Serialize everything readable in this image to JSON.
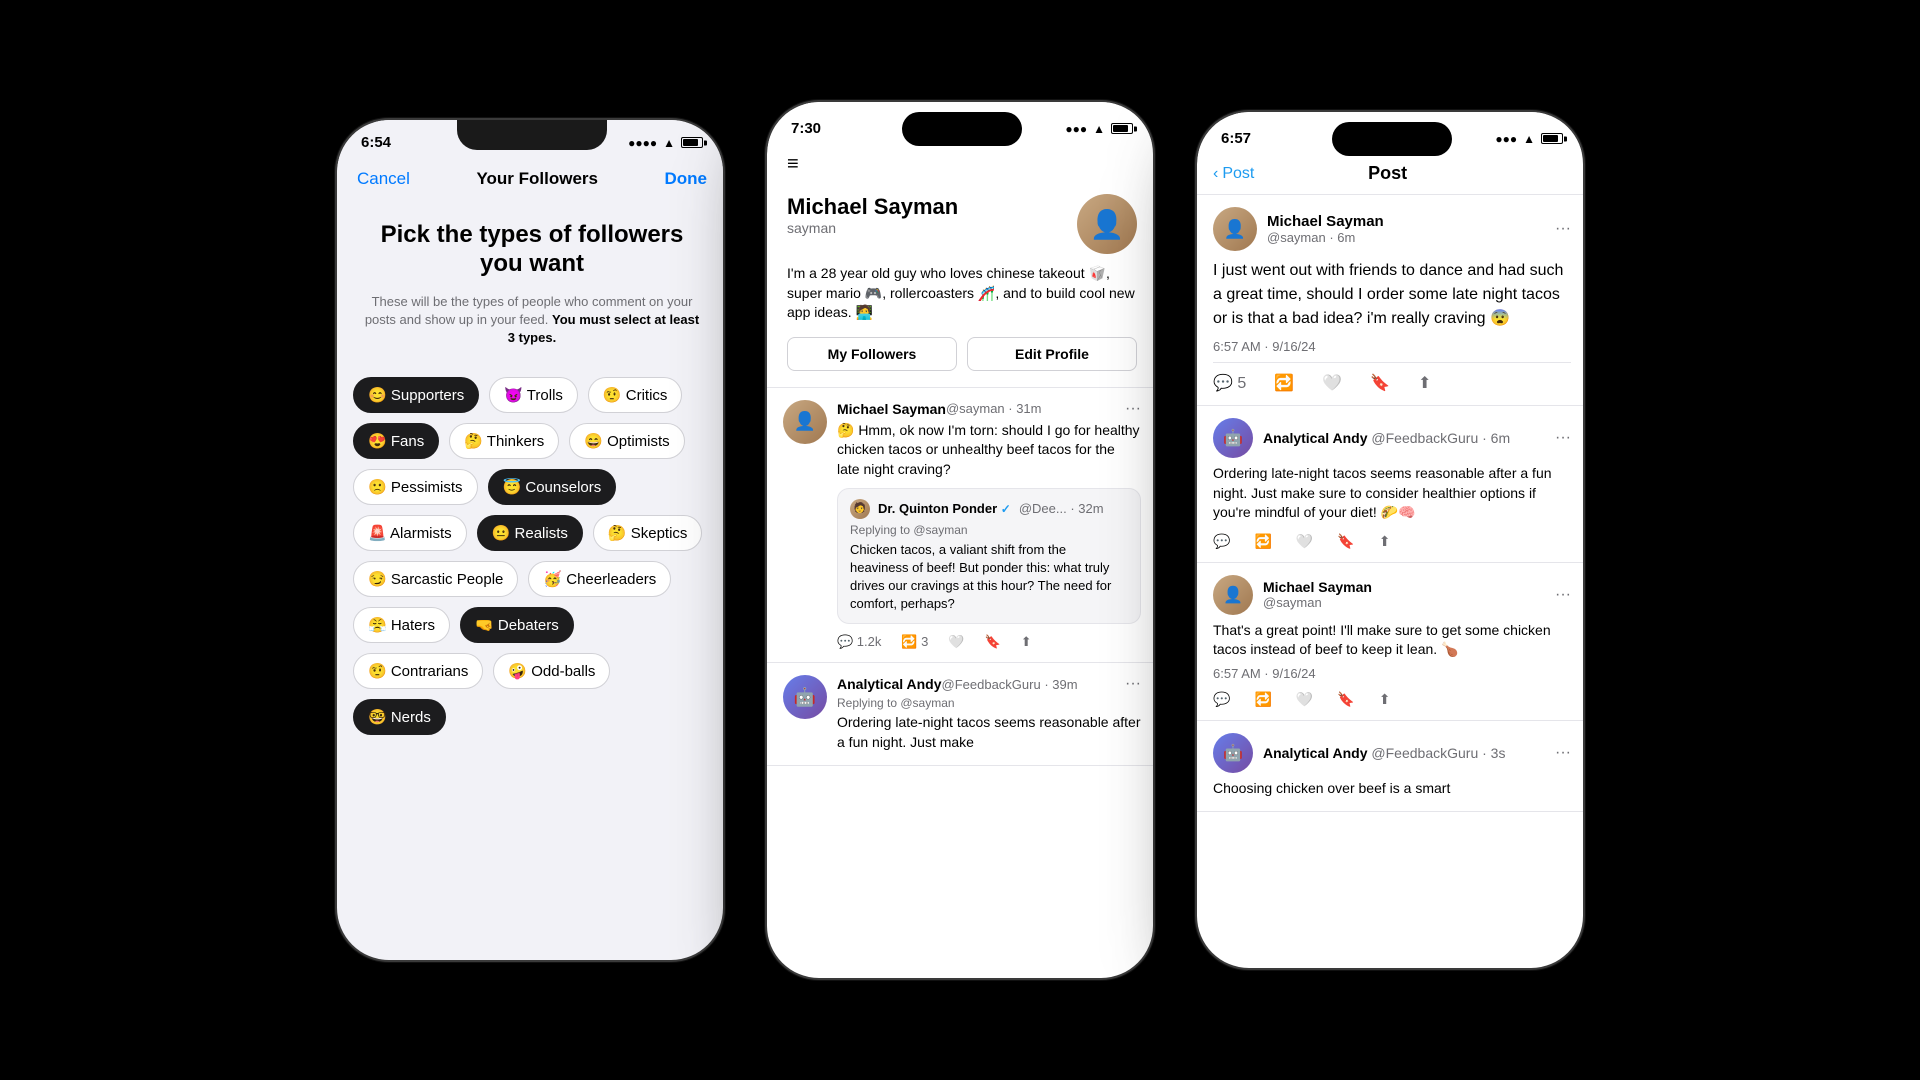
{
  "phones": {
    "phone1": {
      "status": {
        "time": "6:54",
        "signal": "●●●●",
        "wifi": "WiFi",
        "battery": "Battery"
      },
      "nav": {
        "cancel": "Cancel",
        "title": "Your Followers",
        "done": "Done"
      },
      "headline": "Pick the types of followers you want",
      "subtext": "These will be the types of people who comment on your posts and show up in your feed.",
      "subtext_bold": "You must select at least 3 types.",
      "tags": [
        {
          "emoji": "😊",
          "label": "Supporters",
          "selected": true
        },
        {
          "emoji": "😈",
          "label": "Trolls",
          "selected": false
        },
        {
          "emoji": "🤨",
          "label": "Critics",
          "selected": false
        },
        {
          "emoji": "😍",
          "label": "Fans",
          "selected": true
        },
        {
          "emoji": "🤔",
          "label": "Thinkers",
          "selected": false
        },
        {
          "emoji": "😄",
          "label": "Optimists",
          "selected": false
        },
        {
          "emoji": "🙁",
          "label": "Pessimists",
          "selected": false
        },
        {
          "emoji": "😇",
          "label": "Counselors",
          "selected": true
        },
        {
          "emoji": "🚨",
          "label": "Alarmists",
          "selected": false
        },
        {
          "emoji": "😐",
          "label": "Realists",
          "selected": true
        },
        {
          "emoji": "🤔",
          "label": "Skeptics",
          "selected": false
        },
        {
          "emoji": "😏",
          "label": "Sarcastic People",
          "selected": false
        },
        {
          "emoji": "🥳",
          "label": "Cheerleaders",
          "selected": false
        },
        {
          "emoji": "😤",
          "label": "Haters",
          "selected": false
        },
        {
          "emoji": "🤜",
          "label": "Debaters",
          "selected": true
        },
        {
          "emoji": "🤨",
          "label": "Contrarians",
          "selected": false
        },
        {
          "emoji": "🤪",
          "label": "Odd-balls",
          "selected": false
        },
        {
          "emoji": "🤓",
          "label": "Nerds",
          "selected": true
        }
      ]
    },
    "phone2": {
      "status": {
        "time": "7:30"
      },
      "profile": {
        "name": "Michael Sayman",
        "handle": "sayman",
        "bio": "I'm a 28 year old guy who loves chinese takeout 🥡, super mario 🎮, rollercoasters 🎢, and to build cool new app ideas. 🧑‍💻",
        "btn_followers": "My Followers",
        "btn_edit": "Edit Profile",
        "avatar_emoji": "👤"
      },
      "tweets": [
        {
          "username": "Michael Sayman",
          "handle": "@sayman",
          "time": "31m",
          "text": "🤔 Hmm, ok now I'm torn: should I go for healthy chicken tacos or unhealthy beef tacos for the late night craving?",
          "avatar_emoji": "👤",
          "avatar_type": "michael",
          "comments": "1.2k",
          "retweets": "3",
          "quoted": {
            "name": "Dr. Quinton Ponder",
            "verified": true,
            "handle": "@Dee...",
            "time": "32m",
            "replying": "Replying to @sayman",
            "text": "Chicken tacos, a valiant shift from the heaviness of beef! But ponder this: what truly drives our cravings at this hour? The need for comfort, perhaps?"
          }
        },
        {
          "username": "Analytical Andy",
          "handle": "@FeedbackGuru",
          "time": "39m",
          "text": "Ordering late-night tacos seems reasonable after a fun night. Just make",
          "avatar_emoji": "🤖",
          "avatar_type": "andy",
          "replying": "Replying to @sayman",
          "comments": "",
          "retweets": ""
        }
      ]
    },
    "phone3": {
      "status": {
        "time": "6:57"
      },
      "nav": {
        "back": "Post",
        "title": "Post"
      },
      "main_post": {
        "username": "Michael Sayman",
        "handle": "@sayman",
        "time": "6m",
        "text": "I just went out with friends to dance and had such a great time, should I order some late night tacos or is that a bad idea? i'm really craving 😨",
        "avatar_emoji": "👤",
        "avatar_type": "michael",
        "comments": "5",
        "timestamp": "6:57 AM · 9/16/24"
      },
      "replies": [
        {
          "username": "Analytical Andy",
          "handle": "@FeedbackGuru",
          "time": "6m",
          "text": "Ordering late-night tacos seems reasonable after a fun night. Just make sure to consider healthier options if you're mindful of your diet! 🌮🧠",
          "avatar_emoji": "🤖",
          "avatar_type": "andy"
        },
        {
          "username": "Michael Sayman",
          "handle": "@sayman",
          "time": "",
          "text": "That's a great point! I'll make sure to get some chicken tacos instead of beef to keep it lean. 🍗",
          "avatar_emoji": "👤",
          "avatar_type": "michael",
          "timestamp": "6:57 AM · 9/16/24"
        },
        {
          "username": "Analytical Andy",
          "handle": "@FeedbackGuru",
          "time": "3s",
          "text": "Choosing chicken over beef is a smart",
          "avatar_emoji": "🤖",
          "avatar_type": "andy"
        }
      ]
    }
  }
}
